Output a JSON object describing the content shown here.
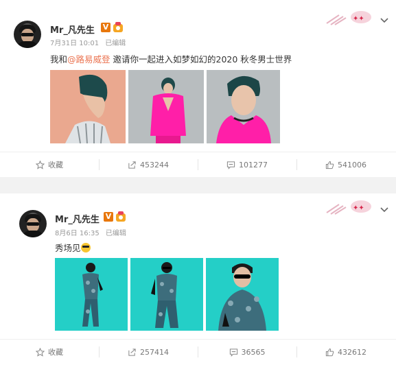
{
  "posts": [
    {
      "username": "Mr_凡先生",
      "verified_badge": "V",
      "medal_icon": "fan-medal-icon",
      "timestamp": "7月31日 10:01",
      "edited": "已编辑",
      "text": {
        "prefix": "我和",
        "mention": "@路易威登",
        "suffix": " 邀请你一起进入如梦如幻的2020 秋冬男士世界"
      },
      "images": [
        "teal-hair-profile-photo",
        "pink-jacket-full-body-photo",
        "pink-jacket-portrait-photo"
      ],
      "actions": {
        "favorite_label": "收藏",
        "repost_count": "453244",
        "comment_count": "101277",
        "like_count": "541006"
      }
    },
    {
      "username": "Mr_凡先生",
      "verified_badge": "V",
      "medal_icon": "fan-medal-icon",
      "timestamp": "8月6日 16:35",
      "edited": "已编辑",
      "text": {
        "prefix": "秀场见",
        "mention": "",
        "suffix": ""
      },
      "images": [
        "cyan-backdrop-full-body-photo-1",
        "cyan-backdrop-full-body-photo-2",
        "cyan-backdrop-half-body-photo"
      ],
      "actions": {
        "favorite_label": "收藏",
        "repost_count": "257414",
        "comment_count": "36565",
        "like_count": "432612"
      }
    }
  ],
  "colors": {
    "mention": "#eb7350",
    "verified": "#e8770c",
    "post1_photo_bg": "#b7bcbe",
    "post1_photo1_bg": "#e8a890",
    "post2_photo_bg": "#23d0c8",
    "pink_jacket": "#ff1fa8"
  }
}
